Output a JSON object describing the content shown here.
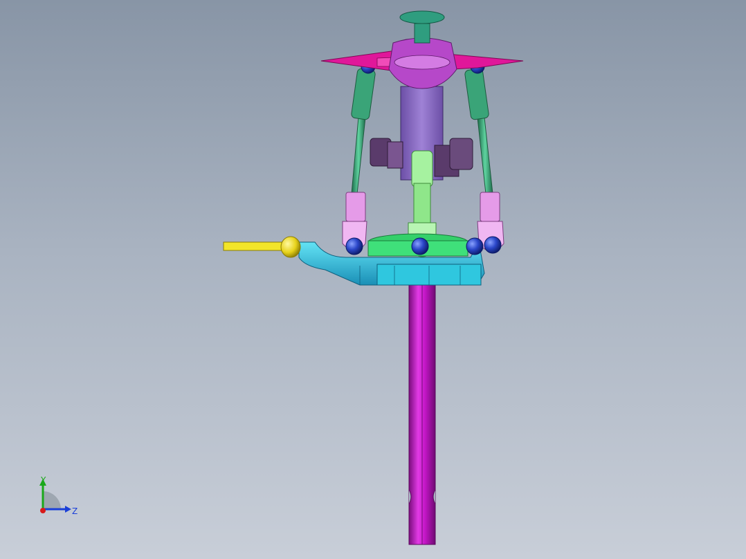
{
  "model": {
    "parts": [
      "shaft",
      "swashplate",
      "flybar-paddle",
      "head-hub",
      "pushrod-left",
      "pushrod-right",
      "center-link",
      "control-arm",
      "ball-links"
    ]
  },
  "triad": {
    "y_label": "Y",
    "z_label": "Z",
    "colors": {
      "y": "#1aa81a",
      "z": "#1a3fd8",
      "x": "#d81a1a"
    }
  },
  "colors": {
    "shaft": "#c516c8",
    "paddle": "#e0179a",
    "hub": "#b648c9",
    "pushrod": "#2f9d6f",
    "rod_end": "#e59be8",
    "swashplate": "#2fc7df",
    "ball": "#1f3fbf",
    "control_arm": "#f2e52a",
    "center_block": "#8c6cc4",
    "crossbar": "#5a3b6b"
  }
}
